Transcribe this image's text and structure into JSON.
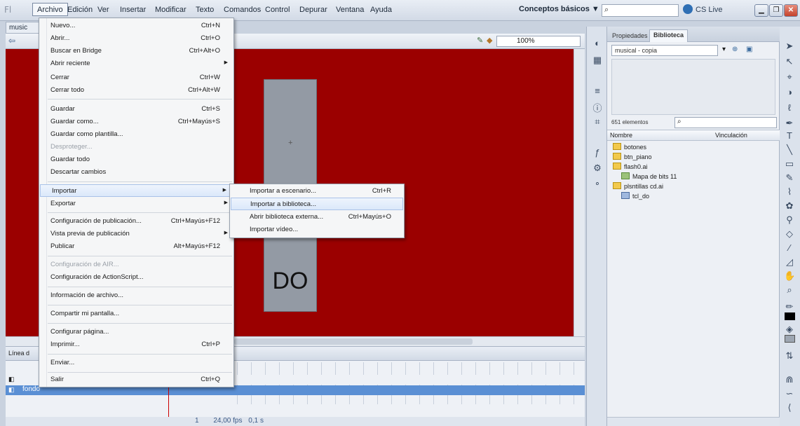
{
  "app": {
    "logo": "Fl",
    "menus": [
      "Archivo",
      "Edición",
      "Ver",
      "Insertar",
      "Modificar",
      "Texto",
      "Comandos",
      "Control",
      "Depurar",
      "Ventana",
      "Ayuda"
    ],
    "workspace": "Conceptos básicos ▼",
    "cs_live": "CS Live"
  },
  "document": {
    "tab": "music",
    "zoom": "100%",
    "key_label": "DO"
  },
  "file_menu": {
    "items": [
      {
        "label": "Nuevo...",
        "shortcut": "Ctrl+N"
      },
      {
        "label": "Abrir...",
        "shortcut": "Ctrl+O"
      },
      {
        "label": "Buscar en Bridge",
        "shortcut": "Ctrl+Alt+O"
      },
      {
        "label": "Abrir reciente",
        "shortcut": ""
      },
      {
        "label": "Cerrar",
        "shortcut": "Ctrl+W"
      },
      {
        "label": "Cerrar todo",
        "shortcut": "Ctrl+Alt+W"
      },
      {
        "label": "Guardar",
        "shortcut": "Ctrl+S"
      },
      {
        "label": "Guardar como...",
        "shortcut": "Ctrl+Mayús+S"
      },
      {
        "label": "Guardar como plantilla...",
        "shortcut": ""
      },
      {
        "label": "Desproteger...",
        "shortcut": ""
      },
      {
        "label": "Guardar todo",
        "shortcut": ""
      },
      {
        "label": "Descartar cambios",
        "shortcut": ""
      },
      {
        "label": "Importar",
        "shortcut": ""
      },
      {
        "label": "Exportar",
        "shortcut": ""
      },
      {
        "label": "Configuración de publicación...",
        "shortcut": "Ctrl+Mayús+F12"
      },
      {
        "label": "Vista previa de publicación",
        "shortcut": ""
      },
      {
        "label": "Publicar",
        "shortcut": "Alt+Mayús+F12"
      },
      {
        "label": "Configuración de AIR...",
        "shortcut": ""
      },
      {
        "label": "Configuración de ActionScript...",
        "shortcut": ""
      },
      {
        "label": "Información de archivo...",
        "shortcut": ""
      },
      {
        "label": "Compartir mi pantalla...",
        "shortcut": ""
      },
      {
        "label": "Configurar página...",
        "shortcut": ""
      },
      {
        "label": "Imprimir...",
        "shortcut": "Ctrl+P"
      },
      {
        "label": "Enviar...",
        "shortcut": ""
      },
      {
        "label": "Salir",
        "shortcut": "Ctrl+Q"
      }
    ]
  },
  "import_menu": {
    "items": [
      {
        "label": "Importar a escenario...",
        "shortcut": "Ctrl+R"
      },
      {
        "label": "Importar a biblioteca...",
        "shortcut": ""
      },
      {
        "label": "Abrir biblioteca externa...",
        "shortcut": "Ctrl+Mayús+O"
      },
      {
        "label": "Importar vídeo...",
        "shortcut": ""
      }
    ]
  },
  "panel": {
    "tab_properties": "Propiedades",
    "tab_library": "Biblioteca",
    "library_select": "musical - copia",
    "element_count": "651 elementos",
    "col_name": "Nombre",
    "col_link": "Vinculación",
    "items": [
      {
        "label": "botones"
      },
      {
        "label": "btn_piano"
      },
      {
        "label": "flash0.ai"
      },
      {
        "label": "Mapa de bits 11"
      },
      {
        "label": "plsntillas cd.ai"
      },
      {
        "label": "tcl_do"
      }
    ]
  },
  "timeline": {
    "header": "Línea d",
    "layer_name": "fondo",
    "fps": "24,00 fps",
    "time": "0,1 s",
    "frame": "1"
  },
  "colors": {
    "stage": "#9b0000",
    "key": "#939aa4"
  }
}
